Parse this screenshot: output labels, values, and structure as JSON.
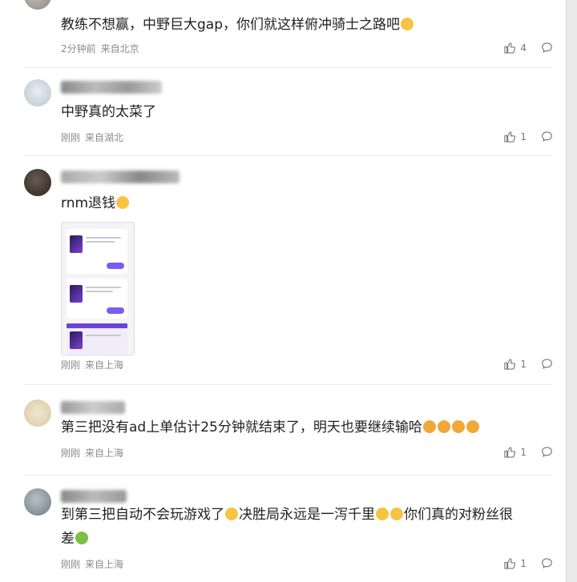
{
  "comments": [
    {
      "text": "教练不想赢，中野巨大gap，你们就这样俯冲骑士之路吧",
      "time": "2分钟前",
      "location": "来自北京",
      "likes": "4",
      "emoji_end": "smirk"
    },
    {
      "text": "中野真的太菜了",
      "time": "刚刚",
      "location": "来自湖北",
      "likes": "1"
    },
    {
      "text": "rnm退钱",
      "time": "刚刚",
      "location": "来自上海",
      "likes": "1",
      "emoji_end": "smile",
      "has_image": true
    },
    {
      "text": "第三把没有ad上单估计25分钟就结束了，明天也要继续输哈",
      "time": "刚刚",
      "location": "来自上海",
      "likes": "1",
      "emoji_end": "heart-eyes x4"
    },
    {
      "text_part1": "到第三把自动不会玩游戏了",
      "text_part2": "决胜局永远是一泻千里",
      "text_part3": "你们真的对粉丝很",
      "text_line2": "差",
      "time": "刚刚",
      "location": "来自上海",
      "likes": "1"
    }
  ],
  "icons": {
    "like": "thumbs-up-icon",
    "reply": "speech-bubble-icon"
  },
  "colors": {
    "meta": "#8a8a8a",
    "text": "#1f1f1f",
    "emoji_yellow": "#f6c445"
  }
}
